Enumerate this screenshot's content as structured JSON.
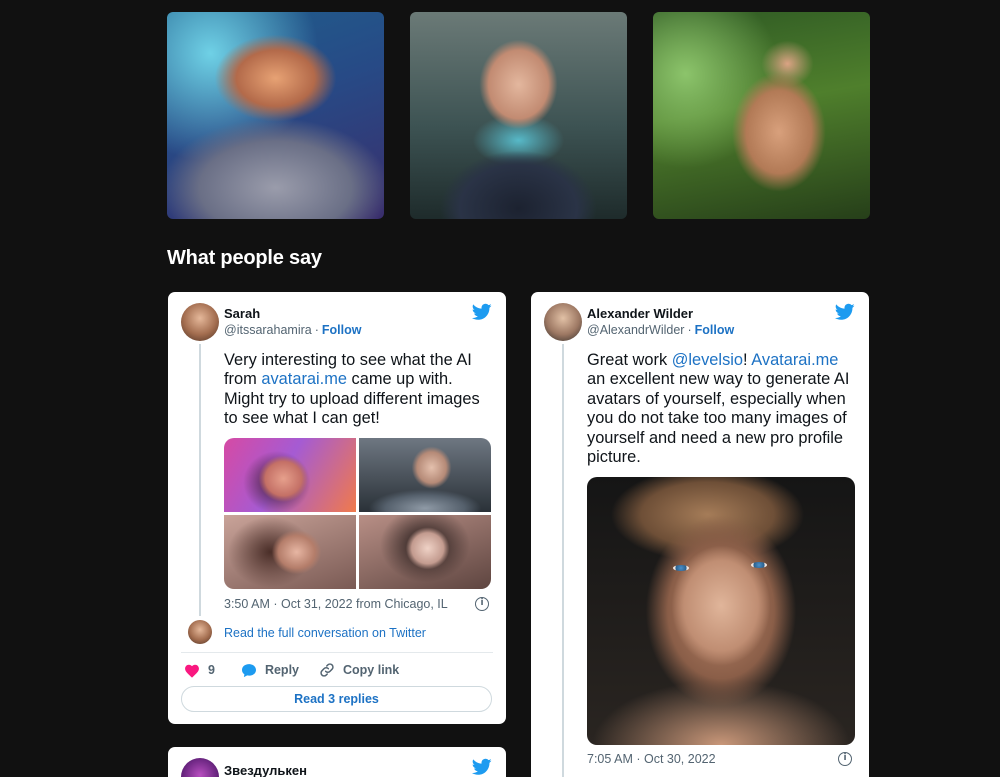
{
  "section_title": "What people say",
  "gallery": {
    "images": [
      "avatar-portrait-cyborg",
      "avatar-portrait-suit",
      "avatar-portrait-jungle"
    ]
  },
  "tweets": [
    {
      "name": "Sarah",
      "handle": "@itssarahamira",
      "separator": "·",
      "follow_label": "Follow",
      "text_parts": [
        "Very interesting to see what the AI from ",
        "avatarai.me",
        " came up with. Might try to upload different images to see what I can get!"
      ],
      "meta": "3:50 AM · Oct 31, 2022 from Chicago, IL",
      "read_conversation": "Read the full conversation on Twitter",
      "likes": "9",
      "reply_label": "Reply",
      "copy_link_label": "Copy link",
      "replies_button": "Read 3 replies"
    },
    {
      "name": "Alexander Wilder",
      "handle": "@AlexandrWilder",
      "separator": "·",
      "follow_label": "Follow",
      "text_parts": [
        "Great work ",
        "@levelsio",
        "! ",
        "Avatarai.me",
        " an excellent new way to generate AI avatars of yourself, especially when you do not take too many images of yourself and need a new pro profile picture."
      ],
      "meta": "7:05 AM · Oct 30, 2022"
    },
    {
      "name": "Звездулькен"
    }
  ],
  "info_icon_glyph": "i",
  "colors": {
    "page_background": "#111111",
    "link_blue": "#1d72c4",
    "twitter_blue": "#1d9bf0",
    "heart_pink": "#f91880"
  }
}
